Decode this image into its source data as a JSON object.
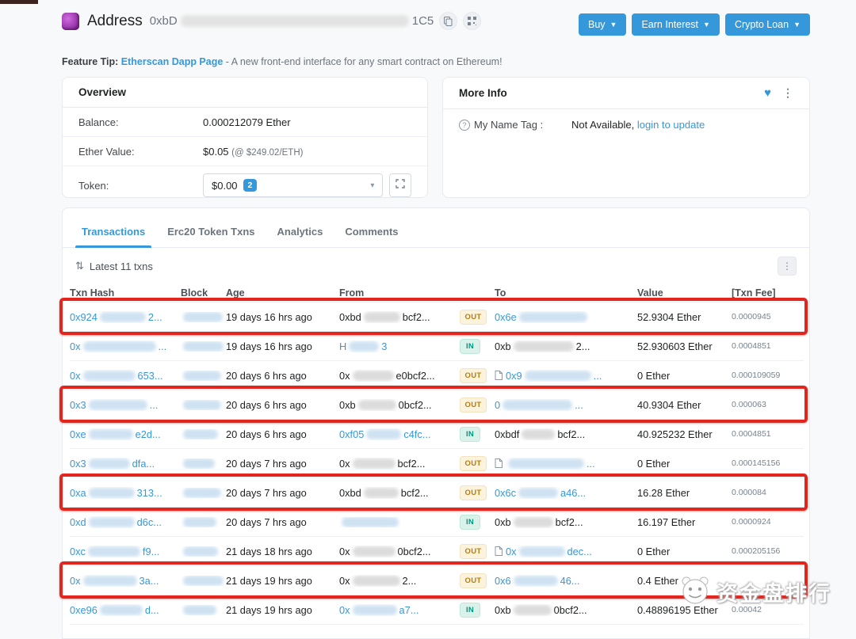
{
  "header": {
    "title": "Address",
    "address_prefix": "0xbD",
    "address_suffix": "1C5",
    "buttons": [
      {
        "label": "Buy"
      },
      {
        "label": "Earn Interest"
      },
      {
        "label": "Crypto Loan"
      }
    ]
  },
  "feature_tip": {
    "label": "Feature Tip:",
    "link": "Etherscan Dapp Page",
    "rest": " - A new front-end interface for any smart contract on Ethereum!"
  },
  "overview": {
    "title": "Overview",
    "balance_label": "Balance:",
    "balance_value": "0.000212079 Ether",
    "ether_value_label": "Ether Value:",
    "ether_value": "$0.05",
    "ether_rate": "(@ $249.02/ETH)",
    "token_label": "Token:",
    "token_value": "$0.00",
    "token_count": "2"
  },
  "more_info": {
    "title": "More Info",
    "name_tag_label": "My Name Tag :",
    "value": "Not Available,",
    "link": "login to update"
  },
  "tabs": [
    {
      "label": "Transactions",
      "active": true
    },
    {
      "label": "Erc20 Token Txns",
      "active": false
    },
    {
      "label": "Analytics",
      "active": false
    },
    {
      "label": "Comments",
      "active": false
    }
  ],
  "txn_bar": {
    "label": "Latest 11 txns"
  },
  "table": {
    "headers": [
      "Txn Hash",
      "Block",
      "Age",
      "From",
      "",
      "To",
      "Value",
      "[Txn Fee]"
    ],
    "rows": [
      {
        "boxed": true,
        "hash": {
          "pre": "0x924",
          "blur": 58,
          "post": "2..."
        },
        "block": 50,
        "age": "19 days 16 hrs ago",
        "from": {
          "pre": "0xbd",
          "blur": 46,
          "post": "bcf2...",
          "link": false
        },
        "dir": "OUT",
        "to": {
          "pre": "0x6e",
          "blur": 86,
          "post": "",
          "link": true,
          "contract": false
        },
        "value": "52.9304 Ether",
        "fee": "0.0000945"
      },
      {
        "boxed": false,
        "hash": {
          "pre": "0x",
          "blur": 92,
          "post": "..."
        },
        "block": 54,
        "age": "19 days 16 hrs ago",
        "from": {
          "pre": "H",
          "blur": 38,
          "post": "3",
          "link": true
        },
        "dir": "IN",
        "to": {
          "pre": "0xb",
          "blur": 76,
          "post": "2...",
          "link": false,
          "contract": false
        },
        "value": "52.930603 Ether",
        "fee": "0.0004851"
      },
      {
        "boxed": false,
        "hash": {
          "pre": "0x",
          "blur": 66,
          "post": "653..."
        },
        "block": 48,
        "age": "20 days 6 hrs ago",
        "from": {
          "pre": "0x",
          "blur": 52,
          "post": "e0bcf2...",
          "link": false
        },
        "dir": "OUT",
        "to": {
          "pre": "0x9",
          "blur": 84,
          "post": "...",
          "link": true,
          "contract": true
        },
        "value": "0 Ether",
        "fee": "0.000109059"
      },
      {
        "boxed": true,
        "hash": {
          "pre": "0x3",
          "blur": 74,
          "post": "..."
        },
        "block": 48,
        "age": "20 days 6 hrs ago",
        "from": {
          "pre": "0xb",
          "blur": 48,
          "post": "0bcf2...",
          "link": false
        },
        "dir": "OUT",
        "to": {
          "pre": "0",
          "blur": 88,
          "post": "...",
          "link": true,
          "contract": false
        },
        "value": "40.9304 Ether",
        "fee": "0.000063"
      },
      {
        "boxed": false,
        "hash": {
          "pre": "0xe",
          "blur": 56,
          "post": "e2d..."
        },
        "block": 44,
        "age": "20 days 6 hrs ago",
        "from": {
          "pre": "0xf05",
          "blur": 44,
          "post": "c4fc...",
          "link": true
        },
        "dir": "IN",
        "to": {
          "pre": "0xbdf",
          "blur": 42,
          "post": "bcf2...",
          "link": false,
          "contract": false
        },
        "value": "40.925232 Ether",
        "fee": "0.0004851"
      },
      {
        "boxed": false,
        "hash": {
          "pre": "0x3",
          "blur": 52,
          "post": "dfa..."
        },
        "block": 40,
        "age": "20 days 7 hrs ago",
        "from": {
          "pre": "0x",
          "blur": 54,
          "post": "bcf2...",
          "link": false
        },
        "dir": "OUT",
        "to": {
          "pre": "",
          "blur": 96,
          "post": "...",
          "link": true,
          "contract": true
        },
        "value": "0 Ether",
        "fee": "0.000145156"
      },
      {
        "boxed": true,
        "hash": {
          "pre": "0xa",
          "blur": 58,
          "post": "313..."
        },
        "block": 48,
        "age": "20 days 7 hrs ago",
        "from": {
          "pre": "0xbd",
          "blur": 44,
          "post": "bcf2...",
          "link": false
        },
        "dir": "OUT",
        "to": {
          "pre": "0x6c",
          "blur": 50,
          "post": "a46...",
          "link": true,
          "contract": false
        },
        "value": "16.28 Ether",
        "fee": "0.000084"
      },
      {
        "boxed": false,
        "hash": {
          "pre": "0xd",
          "blur": 58,
          "post": "d6c..."
        },
        "block": 42,
        "age": "20 days 7 hrs ago",
        "from": {
          "pre": "",
          "blur": 72,
          "post": "",
          "link": true
        },
        "dir": "IN",
        "to": {
          "pre": "0xb",
          "blur": 50,
          "post": "bcf2...",
          "link": false,
          "contract": false
        },
        "value": "16.197 Ether",
        "fee": "0.0000924"
      },
      {
        "boxed": false,
        "hash": {
          "pre": "0xc",
          "blur": 66,
          "post": "f9..."
        },
        "block": 44,
        "age": "21 days 18 hrs ago",
        "from": {
          "pre": "0x",
          "blur": 54,
          "post": "0bcf2...",
          "link": false
        },
        "dir": "OUT",
        "to": {
          "pre": "0x",
          "blur": 58,
          "post": "dec...",
          "link": true,
          "contract": true
        },
        "value": "0 Ether",
        "fee": "0.000205156"
      },
      {
        "boxed": true,
        "hash": {
          "pre": "0x",
          "blur": 68,
          "post": "3a..."
        },
        "block": 52,
        "age": "21 days 19 hrs ago",
        "from": {
          "pre": "0x",
          "blur": 60,
          "post": "2...",
          "link": false
        },
        "dir": "OUT",
        "to": {
          "pre": "0x6",
          "blur": 56,
          "post": "46...",
          "link": true,
          "contract": false
        },
        "value": "0.4 Ether",
        "fee": ""
      },
      {
        "boxed": false,
        "hash": {
          "pre": "0xe96",
          "blur": 54,
          "post": "d..."
        },
        "block": 42,
        "age": "21 days 19 hrs ago",
        "from": {
          "pre": "0x",
          "blur": 56,
          "post": "a7...",
          "link": true
        },
        "dir": "IN",
        "to": {
          "pre": "0xb",
          "blur": 48,
          "post": "0bcf2...",
          "link": false,
          "contract": false
        },
        "value": "0.48896195 Ether",
        "fee": "0.00042"
      }
    ]
  },
  "watermark": {
    "text": "资金盘排行"
  },
  "colors": {
    "accent_blue": "#3498db",
    "annotation_red": "#e3251d",
    "badge_out_text": "#b47d13",
    "badge_in_text": "#02977e",
    "page_bg": "#f8f9fa"
  }
}
